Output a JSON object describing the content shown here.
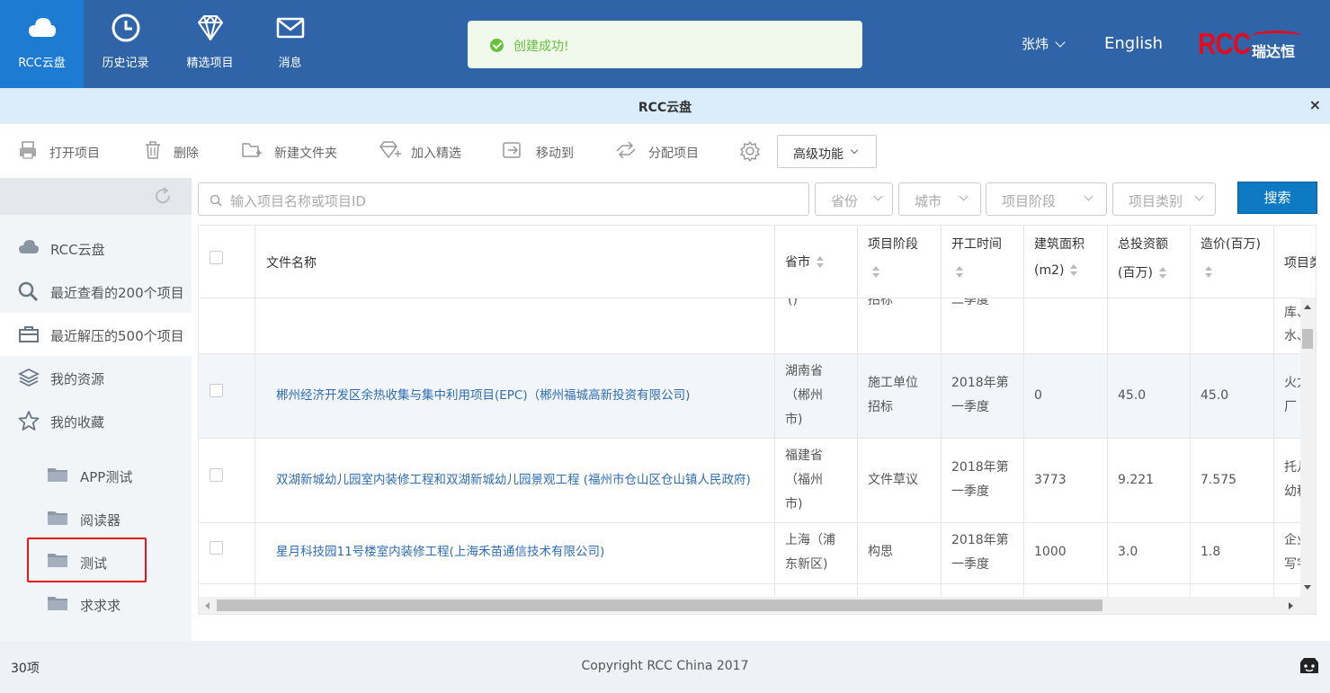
{
  "nav": {
    "items": [
      {
        "label": "RCC云盘",
        "icon": "cloud-icon",
        "active": true
      },
      {
        "label": "历史记录",
        "icon": "clock-icon"
      },
      {
        "label": "精选项目",
        "icon": "diamond-icon"
      },
      {
        "label": "消息",
        "icon": "mail-icon"
      }
    ],
    "toast": "创建成功!",
    "user": "张炜",
    "language": "English",
    "logo_text": "RCC",
    "logo_cn": "瑞达恒"
  },
  "subbar": {
    "title": "RCC云盘",
    "close": "×"
  },
  "toolbar": {
    "open": "打开项目",
    "delete": "删除",
    "new_folder": "新建文件夹",
    "add_featured": "加入精选",
    "move_to": "移动到",
    "assign": "分配项目",
    "advanced": "高级功能"
  },
  "sidebar": {
    "items": [
      {
        "label": "RCC云盘",
        "icon": "cloud-icon"
      },
      {
        "label": "最近查看的200个项目",
        "icon": "search-icon"
      },
      {
        "label": "最近解压的500个项目",
        "icon": "briefcase-icon",
        "active": true
      },
      {
        "label": "我的资源",
        "icon": "layers-icon"
      },
      {
        "label": "我的收藏",
        "icon": "star-icon"
      }
    ],
    "folders": [
      {
        "label": "APP测试"
      },
      {
        "label": "阅读器"
      },
      {
        "label": "测试",
        "highlighted": true
      },
      {
        "label": "求求求"
      }
    ]
  },
  "search": {
    "placeholder": "输入项目名称或项目ID",
    "province": "省份",
    "city": "城市",
    "stage": "项目阶段",
    "category": "项目类别",
    "button": "搜索"
  },
  "table": {
    "headers": {
      "name": "文件名称",
      "province": "省市",
      "stage": "项目阶段",
      "start": "开工时间",
      "area_1": "建筑面积",
      "area_2": "(m2)",
      "invest_1": "总投资额",
      "invest_2": "(百万)",
      "cost": "造价(百万)",
      "category": "项目类"
    },
    "partial_row": {
      "province": "()",
      "stage": "招标",
      "start": "二季度",
      "category_1": "库、",
      "category_2": "水、"
    },
    "rows": [
      {
        "name": "郴州经济开发区余热收集与集中利用项目(EPC)（郴州福城高新投资有限公司)",
        "prov_1": "湖南省",
        "prov_2": "（郴州",
        "prov_3": "市)",
        "stage_1": "施工单位",
        "stage_2": "招标",
        "start_1": "2018年第",
        "start_2": "一季度",
        "area": "0",
        "invest": "45.0",
        "cost": "45.0",
        "cat_1": "火力",
        "cat_2": "厂"
      },
      {
        "name": "双湖新城幼儿园室内装修工程和双湖新城幼儿园景观工程 (福州市仓山区仓山镇人民政府)",
        "prov_1": "福建省",
        "prov_2": "（福州",
        "prov_3": "市)",
        "stage_1": "文件草议",
        "stage_2": "",
        "start_1": "2018年第",
        "start_2": "一季度",
        "area": "3773",
        "invest": "9.221",
        "cost": "7.575",
        "cat_1": "托儿",
        "cat_2": "幼稚"
      },
      {
        "name": "星月科技园11号楼室内装修工程(上海禾苗通信技术有限公司)",
        "prov_1": "上海（浦",
        "prov_2": "东新区)",
        "prov_3": "",
        "stage_1": "构思",
        "stage_2": "",
        "start_1": "2018年第",
        "start_2": "一季度",
        "area": "1000",
        "invest": "3.0",
        "cost": "1.8",
        "cat_1": "企业",
        "cat_2": "写字"
      }
    ]
  },
  "footer": {
    "count": "30项",
    "copyright": "Copyright RCC China 2017"
  },
  "colors": {
    "topbar": "#2f65a8",
    "active_nav": "#1d7bd1",
    "link": "#2e6db4",
    "primary_button": "#0e7ac4",
    "highlight_border": "#e4171b",
    "toast_green": "#67c23a"
  }
}
